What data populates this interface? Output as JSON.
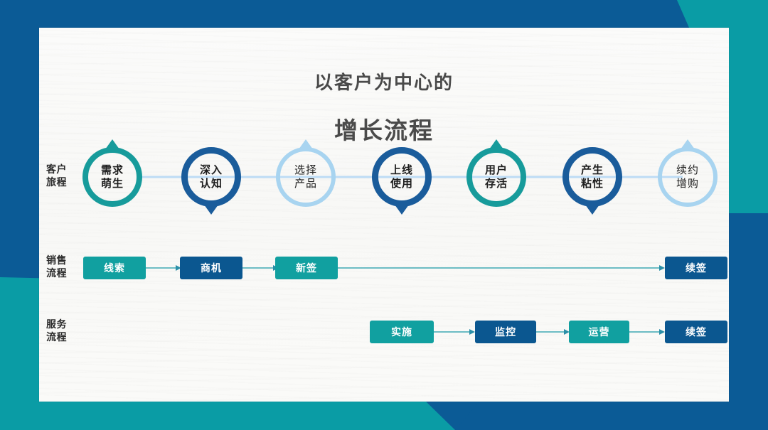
{
  "theme": {
    "blue_dark": "#0B5B96",
    "teal": "#0A9CA5",
    "box_teal": "#11A0A0",
    "box_blue": "#0B5790",
    "ring_teal": "#179B9B",
    "ring_blue": "#1A5C9B",
    "ring_lightblue": "#A8D4F0",
    "connector": "#BDDCF5",
    "arrow_line": "#3FA9B4",
    "card_bg": "#FAFAF8",
    "title_color": "#4A4A4A"
  },
  "title": {
    "line1": "以客户为中心的",
    "line2": "增长流程"
  },
  "rows": {
    "journey": {
      "label": "客户\n旅程"
    },
    "sales": {
      "label": "销售\n流程"
    },
    "service": {
      "label": "服务\n流程"
    }
  },
  "journey_nodes": [
    {
      "label": "需求\n萌生",
      "style": "teal",
      "pin": "up"
    },
    {
      "label": "深入\n认知",
      "style": "blue",
      "pin": "down"
    },
    {
      "label": "选择\n产品",
      "style": "lightblue",
      "pin": "up"
    },
    {
      "label": "上线\n使用",
      "style": "blue",
      "pin": "down"
    },
    {
      "label": "用户\n存活",
      "style": "teal",
      "pin": "up"
    },
    {
      "label": "产生\n粘性",
      "style": "blue",
      "pin": "down"
    },
    {
      "label": "续约\n增购",
      "style": "lightblue",
      "pin": "up"
    }
  ],
  "sales_boxes": [
    {
      "label": "线索",
      "style": "teal"
    },
    {
      "label": "商机",
      "style": "blue"
    },
    {
      "label": "新签",
      "style": "teal"
    },
    {
      "label": "续签",
      "style": "blue"
    }
  ],
  "service_boxes": [
    {
      "label": "实施",
      "style": "teal"
    },
    {
      "label": "监控",
      "style": "blue"
    },
    {
      "label": "运营",
      "style": "teal"
    },
    {
      "label": "续签",
      "style": "blue"
    }
  ]
}
